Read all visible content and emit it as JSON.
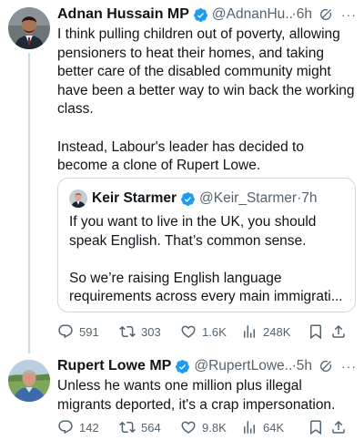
{
  "tweets": [
    {
      "name": "Adnan Hussain MP",
      "handle": "@AdnanHu...",
      "separator": "·",
      "time": "6h",
      "more": "···",
      "text": "I think pulling children out of poverty, allowing pensioners to heat their homes, and taking better care of the disabled community might have been a better way to win back the working class.\n\nInstead, Labour's leader has decided to become a clone of Rupert Lowe.",
      "quote": {
        "name": "Keir Starmer",
        "handle": "@Keir_Starmer",
        "separator": "·",
        "time": "7h",
        "text": "If you want to live in the UK, you should speak English. That’s common sense.\n\nSo we’re raising English language requirements across every main immigrati..."
      },
      "stats": {
        "replies": "591",
        "reposts": "303",
        "likes": "1.6K",
        "views": "248K"
      }
    },
    {
      "name": "Rupert Lowe MP",
      "handle": "@RupertLowe...",
      "separator": "·",
      "time": "5h",
      "more": "···",
      "text": "Unless he wants one million plus illegal migrants deported, it's a crap impersonation.",
      "stats": {
        "replies": "142",
        "reposts": "564",
        "likes": "9.8K",
        "views": "64K"
      }
    }
  ],
  "colors": {
    "verified": "#1d9bf0",
    "muted": "#536471",
    "border": "#cfd9de",
    "text": "#0f1419"
  },
  "icons": [
    "verified-badge-icon",
    "grok-icon",
    "more-icon",
    "reply-icon",
    "repost-icon",
    "like-icon",
    "views-icon",
    "bookmark-icon",
    "share-icon"
  ]
}
